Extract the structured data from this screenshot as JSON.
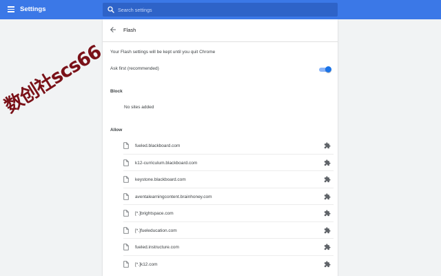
{
  "header": {
    "title": "Settings",
    "menu_icon": "hamburger-menu-icon",
    "search": {
      "placeholder": "Search settings",
      "value": "",
      "icon": "search-icon"
    }
  },
  "page": {
    "title": "Flash",
    "back_icon": "arrow-back-icon",
    "note": "Your Flash settings will be kept until you quit Chrome",
    "ask_first": {
      "label": "Ask first (recommended)",
      "enabled": true
    }
  },
  "block": {
    "heading": "Block",
    "empty_text": "No sites added"
  },
  "allow": {
    "heading": "Allow",
    "sites": [
      {
        "site": "fueled.blackboard.com"
      },
      {
        "site": "k12-curriculum.blackboard.com"
      },
      {
        "site": "keystone.blackboard.com"
      },
      {
        "site": "aventalearningcontent.brainhoney.com"
      },
      {
        "site": "[*.]brightspace.com"
      },
      {
        "site": "[*.]fueleducation.com"
      },
      {
        "site": "fueled.instructure.com"
      },
      {
        "site": "[*.]k12.com"
      }
    ],
    "row_icon": "file-icon",
    "action_icon": "puzzle-extension-icon"
  },
  "watermark": {
    "text": "数创社scs66"
  },
  "colors": {
    "topbar": "#3b78e7",
    "search_bg": "#2e63c8",
    "toggle_on": "#1a73e8",
    "watermark": "#7a1118",
    "page_bg": "#f1f3f4"
  }
}
